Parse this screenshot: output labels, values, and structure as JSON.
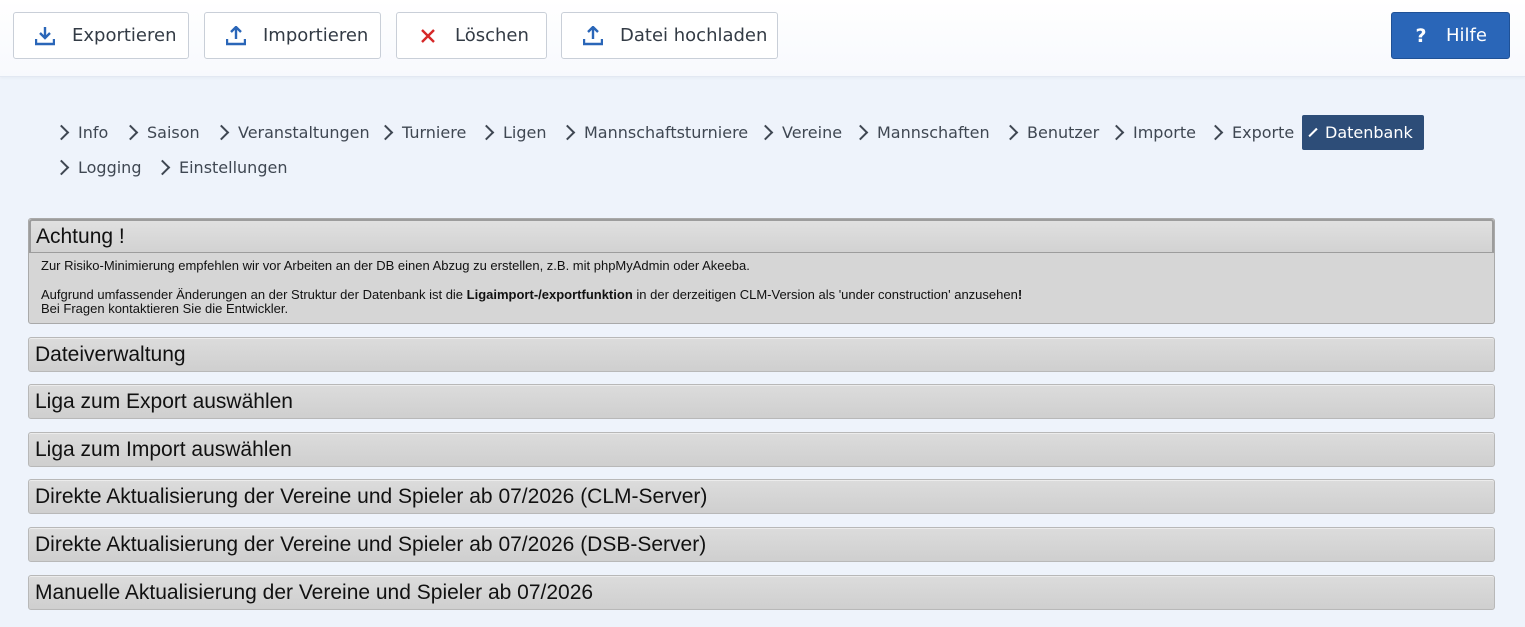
{
  "toolbar": {
    "export_label": "Exportieren",
    "import_label": "Importieren",
    "delete_label": "Löschen",
    "upload_label": "Datei hochladen",
    "help_label": "Hilfe"
  },
  "nav": {
    "items": [
      "Info",
      "Saison",
      "Veranstaltungen",
      "Turniere",
      "Ligen",
      "Mannschaftsturniere",
      "Vereine",
      "Mannschaften",
      "Benutzer",
      "Importe",
      "Exporte",
      "Datenbank",
      "Logging",
      "Einstellungen"
    ],
    "active": "Datenbank"
  },
  "notice": {
    "title": "Achtung !",
    "line1": "Zur Risiko-Minimierung empfehlen wir vor Arbeiten an der DB einen Abzug zu erstellen, z.B. mit phpMyAdmin oder Akeeba.",
    "line2_pre": "Aufgrund umfassender Änderungen an der Struktur der Datenbank ist die ",
    "line2_bold": "Ligaimport-/exportfunktion",
    "line2_post": " in der derzeitigen CLM-Version als 'under construction' anzusehen",
    "line2_end": "!",
    "line3": "Bei Fragen kontaktieren Sie die Entwickler."
  },
  "sections": [
    "Dateiverwaltung",
    "Liga zum Export auswählen",
    "Liga zum Import auswählen",
    "Direkte Aktualisierung der Vereine und Spieler ab 07/2026 (CLM-Server)",
    "Direkte Aktualisierung der Vereine und Spieler ab 07/2026 (DSB-Server)",
    "Manuelle Aktualisierung der Vereine und Spieler ab 07/2026"
  ],
  "colors": {
    "accent": "#2a66b8",
    "nav_active": "#2d4d78",
    "delete": "#d62828"
  }
}
